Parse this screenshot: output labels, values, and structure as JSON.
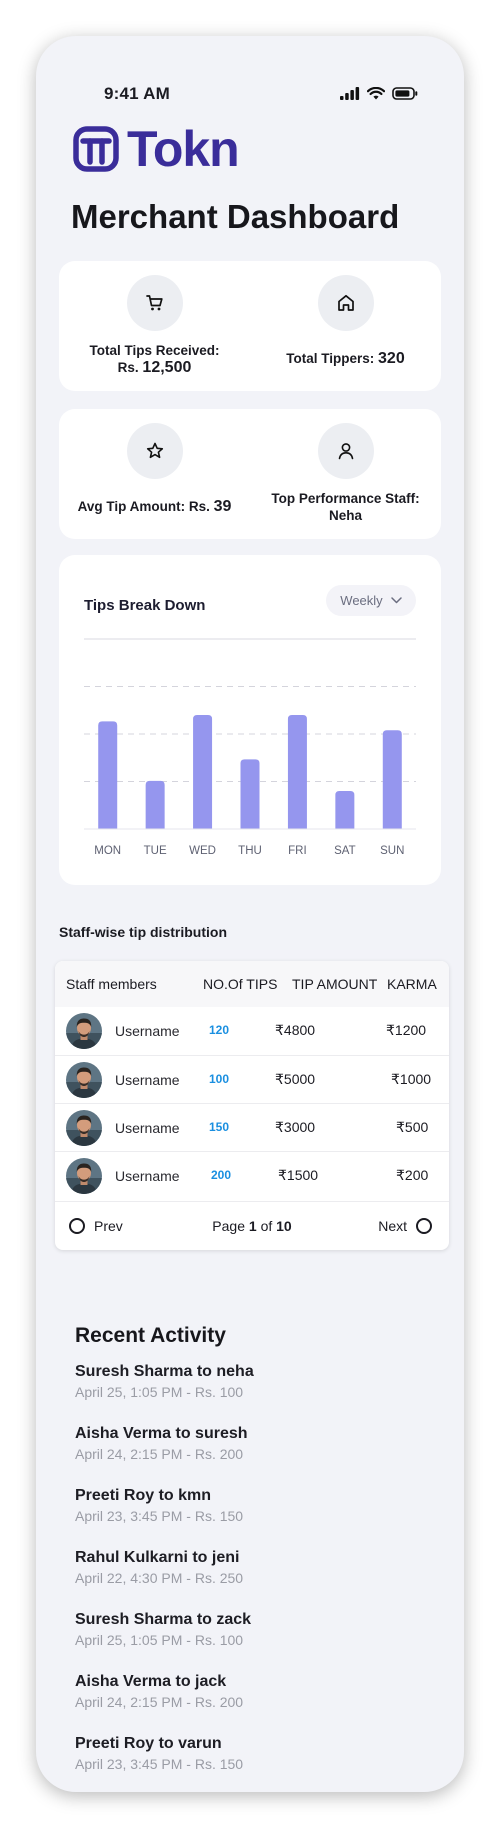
{
  "status_bar": {
    "time": "9:41 AM"
  },
  "brand": {
    "name": "Tokn",
    "color": "#3a2d9a"
  },
  "page_title": "Merchant Dashboard",
  "stats": {
    "total_tips": {
      "label": "Total Tips Received:",
      "prefix": "Rs.",
      "value": "12,500",
      "icon": "cart-icon"
    },
    "total_tippers": {
      "label": "Total Tippers:",
      "value": "320",
      "icon": "home-icon"
    },
    "avg_tip": {
      "label": "Avg Tip Amount: Rs.",
      "value": "39",
      "icon": "star-icon"
    },
    "top_staff": {
      "label": "Top Performance Staff:",
      "value": "Neha",
      "icon": "user-icon"
    }
  },
  "chart": {
    "title": "Tips Break Down",
    "filter": "Weekly",
    "bar_color": "#9596ee"
  },
  "chart_data": {
    "type": "bar",
    "categories": [
      "MON",
      "TUE",
      "WED",
      "THU",
      "FRI",
      "SAT",
      "SUN"
    ],
    "values": [
      85,
      38,
      90,
      55,
      90,
      30,
      78
    ],
    "ylim": [
      0,
      150
    ],
    "grid": true,
    "title": "Tips Break Down",
    "xlabel": "",
    "ylabel": ""
  },
  "staff": {
    "section_title": "Staff-wise tip distribution",
    "columns": [
      "Staff  members",
      "NO.Of TIPS",
      "TIP AMOUNT",
      "KARMA"
    ],
    "rows": [
      {
        "name": "Username",
        "tips": "120",
        "amount": "₹4800",
        "karma": "₹1200"
      },
      {
        "name": "Username",
        "tips": "100",
        "amount": "₹5000",
        "karma": "₹1000"
      },
      {
        "name": "Username",
        "tips": "150",
        "amount": "₹3000",
        "karma": "₹500"
      },
      {
        "name": "Username",
        "tips": "200",
        "amount": "₹1500",
        "karma": "₹200"
      }
    ],
    "pagination": {
      "prev": "Prev",
      "next": "Next",
      "page_word": "Page",
      "current": "1",
      "of_word": "of",
      "total": "10"
    }
  },
  "recent_activity": {
    "title": "Recent Activity",
    "items": [
      {
        "main": "Suresh Sharma to neha",
        "sub": "April 25, 1:05 PM - Rs. 100"
      },
      {
        "main": "Aisha Verma to suresh",
        "sub": "April 24, 2:15 PM - Rs. 200"
      },
      {
        "main": "Preeti Roy to kmn",
        "sub": "April 23, 3:45 PM - Rs. 150"
      },
      {
        "main": "Rahul Kulkarni to jeni",
        "sub": "April 22, 4:30 PM - Rs. 250"
      },
      {
        "main": "Suresh Sharma to zack",
        "sub": "April 25, 1:05 PM - Rs. 100"
      },
      {
        "main": "Aisha Verma to jack",
        "sub": "April 24, 2:15 PM - Rs. 200"
      },
      {
        "main": "Preeti Roy to varun",
        "sub": "April 23, 3:45 PM - Rs. 150"
      }
    ]
  }
}
